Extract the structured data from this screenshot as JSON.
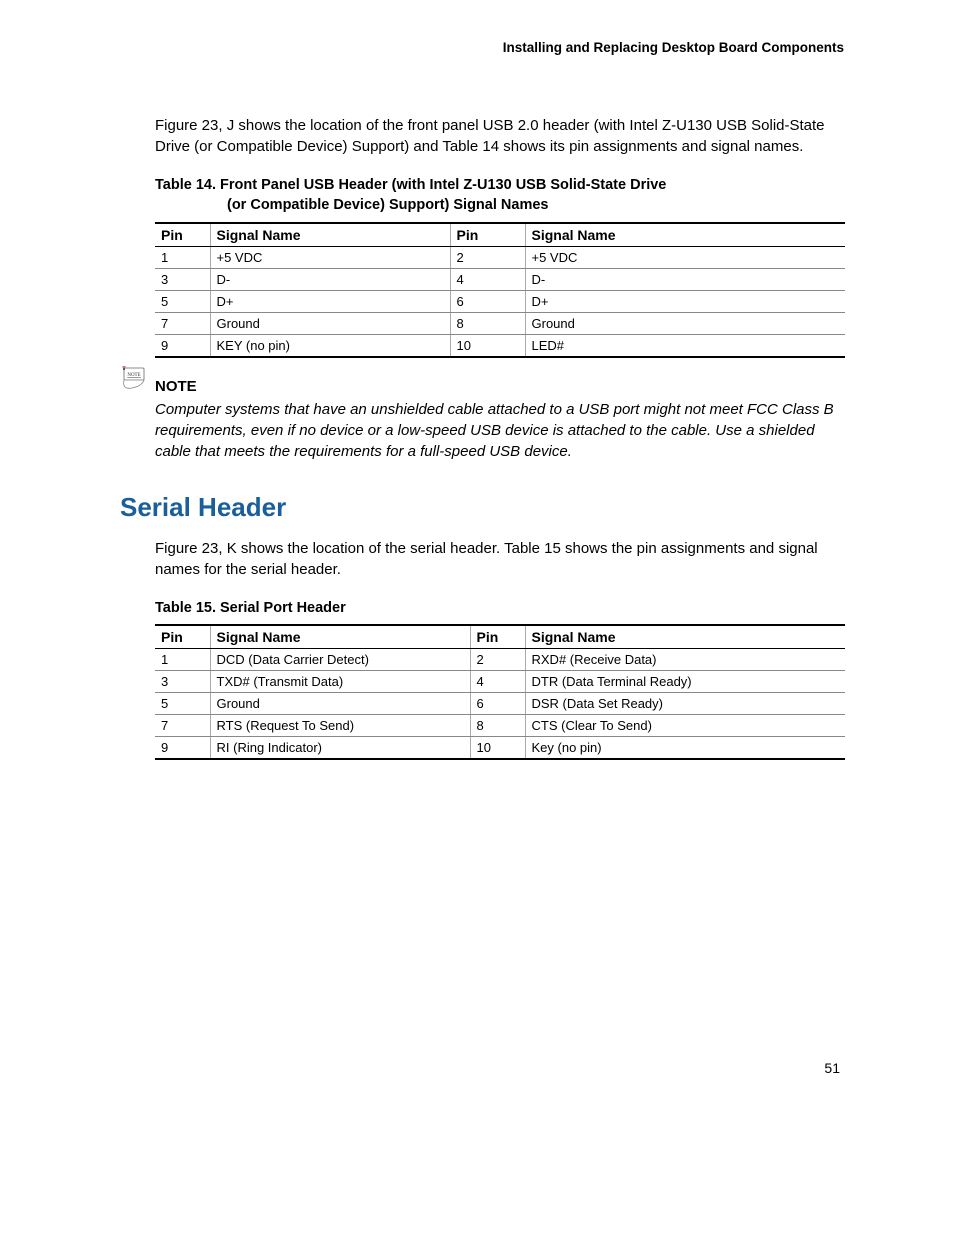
{
  "runningHeader": "Installing and Replacing Desktop Board Components",
  "intro1": "Figure 23, J shows the location of the front panel USB 2.0 header (with Intel Z-U130 USB Solid-State Drive (or Compatible Device) Support) and Table 14 shows its pin assignments and signal names.",
  "table14": {
    "captionLine1": "Table 14.  Front Panel USB Header (with Intel Z-U130 USB Solid-State Drive",
    "captionLine2": "(or Compatible Device) Support) Signal Names",
    "headers": {
      "pinA": "Pin",
      "sigA": "Signal Name",
      "pinB": "Pin",
      "sigB": "Signal Name"
    },
    "rows": [
      {
        "pinA": "1",
        "sigA": "+5 VDC",
        "pinB": "2",
        "sigB": "+5 VDC"
      },
      {
        "pinA": "3",
        "sigA": "D-",
        "pinB": "4",
        "sigB": "D-"
      },
      {
        "pinA": "5",
        "sigA": "D+",
        "pinB": "6",
        "sigB": "D+"
      },
      {
        "pinA": "7",
        "sigA": "Ground",
        "pinB": "8",
        "sigB": "Ground"
      },
      {
        "pinA": "9",
        "sigA": "KEY (no pin)",
        "pinB": "10",
        "sigB": "LED#"
      }
    ]
  },
  "note": {
    "heading": "NOTE",
    "body": "Computer systems that have an unshielded cable attached to a USB port might not meet FCC Class B requirements, even if no device or a low-speed USB device is attached to the cable.  Use a shielded cable that meets the requirements for a full-speed USB device."
  },
  "sectionHeading": "Serial Header",
  "intro2": "Figure 23, K shows the location of the serial header.  Table 15 shows the pin assignments and signal names for the serial header.",
  "table15": {
    "caption": "Table 15. Serial Port Header",
    "headers": {
      "pinA": "Pin",
      "sigA": "Signal Name",
      "pinB": "Pin",
      "sigB": "Signal Name"
    },
    "rows": [
      {
        "pinA": "1",
        "sigA": "DCD (Data Carrier Detect)",
        "pinB": "2",
        "sigB": "RXD# (Receive Data)"
      },
      {
        "pinA": "3",
        "sigA": "TXD# (Transmit Data)",
        "pinB": "4",
        "sigB": "DTR (Data Terminal Ready)"
      },
      {
        "pinA": "5",
        "sigA": "Ground",
        "pinB": "6",
        "sigB": "DSR (Data Set Ready)"
      },
      {
        "pinA": "7",
        "sigA": "RTS (Request To Send)",
        "pinB": "8",
        "sigB": "CTS (Clear To Send)"
      },
      {
        "pinA": "9",
        "sigA": "RI (Ring Indicator)",
        "pinB": "10",
        "sigB": "Key (no pin)"
      }
    ]
  },
  "pageNumber": "51"
}
